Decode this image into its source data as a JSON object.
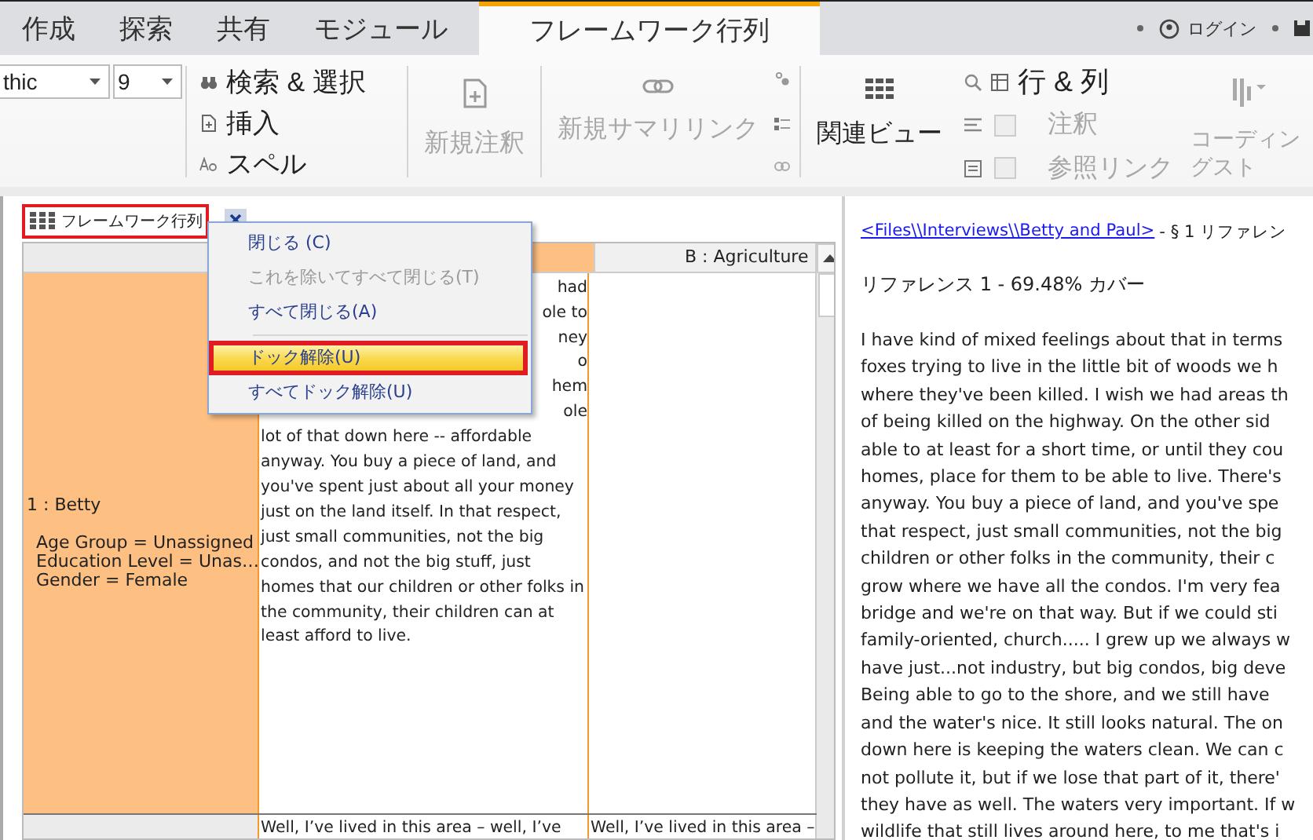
{
  "tabs": [
    {
      "label": "作成",
      "selected": false
    },
    {
      "label": "探索",
      "selected": false
    },
    {
      "label": "共有",
      "selected": false
    },
    {
      "label": "モジュール",
      "selected": false
    },
    {
      "label": "フレームワーク行列",
      "selected": true
    }
  ],
  "account": {
    "label": "ログイン"
  },
  "ribbon": {
    "font_name": "thic",
    "font_size": "9",
    "edit_items": [
      {
        "label": "検索 & 選択"
      },
      {
        "label": "挿入"
      },
      {
        "label": "スペル"
      }
    ],
    "new_buttons": [
      {
        "label": "新規注釈",
        "disabled": true
      },
      {
        "label": "新規サマリリンク",
        "disabled": true
      }
    ],
    "related_view": {
      "label": "関連ビュー"
    },
    "rows_columns": {
      "label": "行 & 列"
    },
    "toggles": [
      {
        "label": "注釈",
        "checked": false,
        "disabled": true
      },
      {
        "label": "参照リンク",
        "checked": false,
        "disabled": true
      }
    ],
    "coding_stripes": {
      "label": "コーディングスト",
      "disabled": true
    }
  },
  "document_tab": {
    "title": "フレームワーク行列"
  },
  "matrix": {
    "columns": [
      {
        "selected": true
      },
      {
        "label": "B : Agriculture",
        "selected": false
      }
    ],
    "rows": [
      {
        "label": "1 : Betty",
        "selected": true,
        "attributes": [
          "Age Group = Unassigned",
          "Education Level = Unas…",
          "Gender = Female"
        ],
        "cells": [
          {
            "lines": [
              "had",
              "ole to",
              "ney",
              "o",
              "hem",
              "ole",
              "lot of that down here -- affordable",
              "anyway. You buy a piece of land, and",
              "you've spent just about all your money",
              "just on the land itself. In that respect,",
              "just small communities, not the big",
              "condos, and not the big stuff, just",
              "homes that our children or other folks in",
              "the community, their children can at",
              "least afford to live."
            ]
          }
        ]
      },
      {
        "selected": false,
        "cells": [
          {
            "lines": [
              "Well, I’ve lived in this area – well, I’ve"
            ]
          },
          {
            "lines": [
              "Well, I’ve lived in this area –"
            ]
          }
        ]
      }
    ]
  },
  "context_menu": {
    "groups": [
      {
        "items": [
          {
            "label": "閉じる (C)",
            "disabled": false,
            "selected": false
          },
          {
            "label": "これを除いてすべて閉じる(T)",
            "disabled": true,
            "selected": false
          },
          {
            "label": "すべて閉じる(A)",
            "disabled": false,
            "selected": false
          }
        ]
      },
      {
        "items": [
          {
            "label": "ドック解除(U)",
            "disabled": false,
            "selected": true
          },
          {
            "label": "すべてドック解除(U)",
            "disabled": false,
            "selected": false
          }
        ]
      }
    ]
  },
  "reference": {
    "source_link": "<Files\\\\Interviews\\\\Betty and Paul>",
    "source_suffix": "- § 1 リファレン",
    "coverage": "リファレンス 1 - 69.48% カバー",
    "lines": [
      "I have kind of mixed feelings about that in terms",
      "foxes trying to live in the little bit of woods we h",
      "where they've been killed. I wish we had areas th",
      "of being killed on the highway. On the other sid",
      "able to at least for a short time, or until they cou",
      "homes, place for them to be able to live. There's",
      "anyway. You buy a piece of land, and you've spe",
      "that respect, just small communities, not the big",
      "children or other folks in the community, their c",
      "grow where we have all the condos. I'm very fea",
      "bridge and we're on that way. But if we could sti",
      "family-oriented, church..... I grew up we always w",
      "have just...not industry, but big condos, big deve",
      "Being able to go to the shore, and we still have",
      "and the water's nice. It still looks natural. The on",
      "down here is keeping the waters clean. We can c",
      "not pollute it, but if we lose that part of it, there'",
      "they have as well. The waters very important. If w",
      "wildlife that still lives around here, to me that's i"
    ]
  }
}
